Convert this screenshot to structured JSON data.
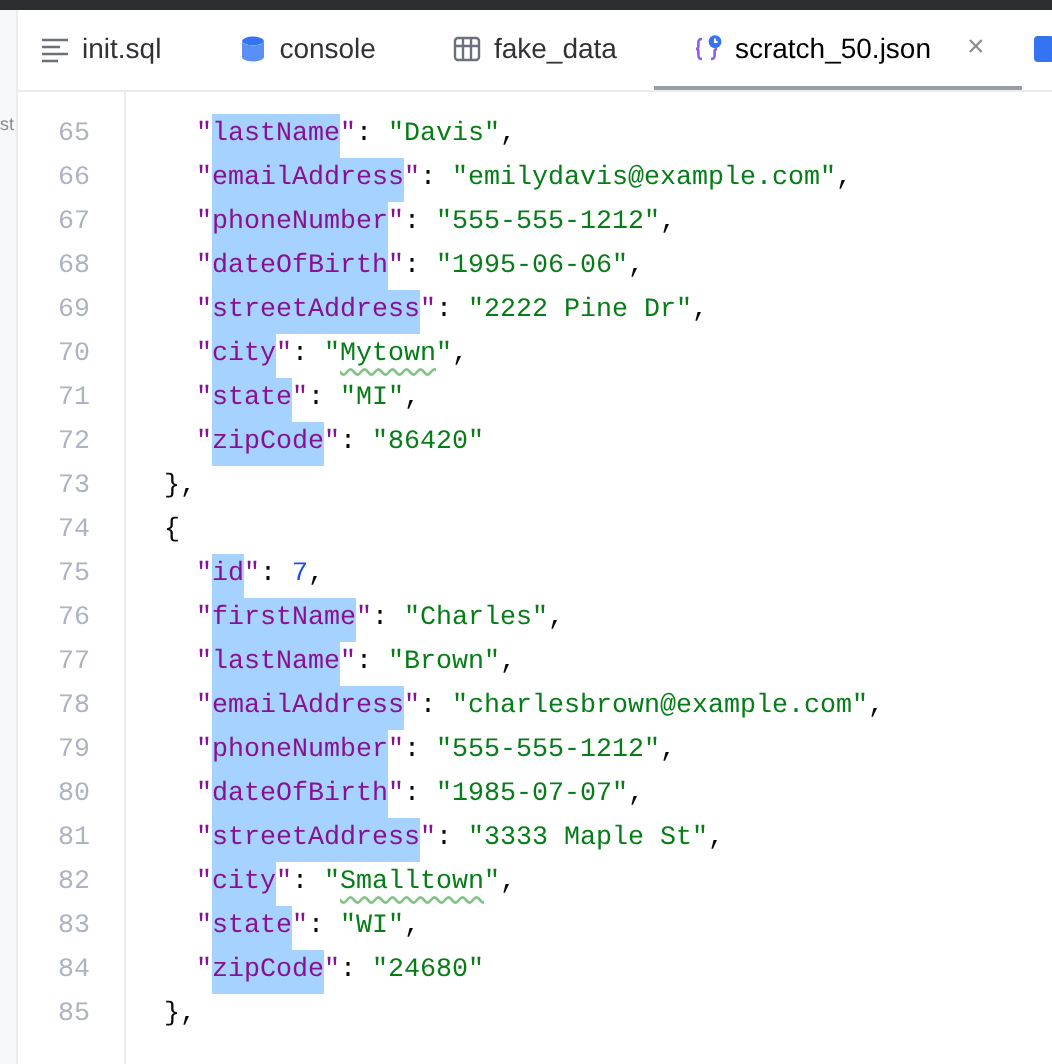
{
  "side_panel": {
    "text": "st"
  },
  "tabs": [
    {
      "label": "init.sql",
      "selected": false
    },
    {
      "label": "console",
      "selected": false
    },
    {
      "label": "fake_data",
      "selected": false
    },
    {
      "label": "scratch_50.json",
      "selected": true,
      "close": "×"
    },
    {
      "selected": false
    }
  ],
  "editor": {
    "lines": [
      {
        "number": "65",
        "tokens": [
          {
            "kind": "key_quote",
            "text": "\""
          },
          {
            "kind": "key",
            "text": "lastName",
            "selected": true
          },
          {
            "kind": "key_quote",
            "text": "\""
          },
          {
            "kind": "punct",
            "text": ": "
          },
          {
            "kind": "string",
            "text": "\"Davis\""
          },
          {
            "kind": "punct",
            "text": ","
          }
        ]
      },
      {
        "number": "66",
        "tokens": [
          {
            "kind": "key_quote",
            "text": "\""
          },
          {
            "kind": "key",
            "text": "emailAddress",
            "selected": true
          },
          {
            "kind": "key_quote",
            "text": "\""
          },
          {
            "kind": "punct",
            "text": ": "
          },
          {
            "kind": "string",
            "text": "\"emilydavis@example.com\""
          },
          {
            "kind": "punct",
            "text": ","
          }
        ]
      },
      {
        "number": "67",
        "tokens": [
          {
            "kind": "key_quote",
            "text": "\""
          },
          {
            "kind": "key",
            "text": "phoneNumber",
            "selected": true
          },
          {
            "kind": "key_quote",
            "text": "\""
          },
          {
            "kind": "punct",
            "text": ": "
          },
          {
            "kind": "string",
            "text": "\"555-555-1212\""
          },
          {
            "kind": "punct",
            "text": ","
          }
        ]
      },
      {
        "number": "68",
        "tokens": [
          {
            "kind": "key_quote",
            "text": "\""
          },
          {
            "kind": "key",
            "text": "dateOfBirth",
            "selected": true
          },
          {
            "kind": "key_quote",
            "text": "\""
          },
          {
            "kind": "punct",
            "text": ": "
          },
          {
            "kind": "string",
            "text": "\"1995-06-06\""
          },
          {
            "kind": "punct",
            "text": ","
          }
        ]
      },
      {
        "number": "69",
        "tokens": [
          {
            "kind": "key_quote",
            "text": "\""
          },
          {
            "kind": "key",
            "text": "streetAddress",
            "selected": true
          },
          {
            "kind": "key_quote",
            "text": "\""
          },
          {
            "kind": "punct",
            "text": ": "
          },
          {
            "kind": "string",
            "text": "\"2222 Pine Dr\""
          },
          {
            "kind": "punct",
            "text": ","
          }
        ]
      },
      {
        "number": "70",
        "tokens": [
          {
            "kind": "key_quote",
            "text": "\""
          },
          {
            "kind": "key",
            "text": "city",
            "selected": true
          },
          {
            "kind": "key_quote",
            "text": "\""
          },
          {
            "kind": "punct",
            "text": ": "
          },
          {
            "kind": "string",
            "text": "\""
          },
          {
            "kind": "string",
            "text": "Mytown",
            "typo": true
          },
          {
            "kind": "string",
            "text": "\""
          },
          {
            "kind": "punct",
            "text": ","
          }
        ]
      },
      {
        "number": "71",
        "tokens": [
          {
            "kind": "key_quote",
            "text": "\""
          },
          {
            "kind": "key",
            "text": "state",
            "selected": true
          },
          {
            "kind": "key_quote",
            "text": "\""
          },
          {
            "kind": "punct",
            "text": ": "
          },
          {
            "kind": "string",
            "text": "\"MI\""
          },
          {
            "kind": "punct",
            "text": ","
          }
        ]
      },
      {
        "number": "72",
        "tokens": [
          {
            "kind": "key_quote",
            "text": "\""
          },
          {
            "kind": "key",
            "text": "zipCode",
            "selected": true
          },
          {
            "kind": "key_quote",
            "text": "\""
          },
          {
            "kind": "punct",
            "text": ": "
          },
          {
            "kind": "string",
            "text": "\"86420\""
          }
        ]
      },
      {
        "number": "73",
        "tokens": [
          {
            "kind": "punct",
            "text": "},"
          }
        ]
      },
      {
        "number": "74",
        "tokens": [
          {
            "kind": "punct",
            "text": "{"
          }
        ]
      },
      {
        "number": "75",
        "tokens": [
          {
            "kind": "key_quote",
            "text": "\""
          },
          {
            "kind": "key",
            "text": "id",
            "selected": true
          },
          {
            "kind": "key_quote",
            "text": "\""
          },
          {
            "kind": "punct",
            "text": ": "
          },
          {
            "kind": "number",
            "text": "7"
          },
          {
            "kind": "punct",
            "text": ","
          }
        ]
      },
      {
        "number": "76",
        "tokens": [
          {
            "kind": "key_quote",
            "text": "\""
          },
          {
            "kind": "key",
            "text": "firstName",
            "selected": true
          },
          {
            "kind": "key_quote",
            "text": "\""
          },
          {
            "kind": "punct",
            "text": ": "
          },
          {
            "kind": "string",
            "text": "\"Charles\""
          },
          {
            "kind": "punct",
            "text": ","
          }
        ]
      },
      {
        "number": "77",
        "tokens": [
          {
            "kind": "key_quote",
            "text": "\""
          },
          {
            "kind": "key",
            "text": "lastName",
            "selected": true
          },
          {
            "kind": "key_quote",
            "text": "\""
          },
          {
            "kind": "punct",
            "text": ": "
          },
          {
            "kind": "string",
            "text": "\"Brown\""
          },
          {
            "kind": "punct",
            "text": ","
          }
        ]
      },
      {
        "number": "78",
        "tokens": [
          {
            "kind": "key_quote",
            "text": "\""
          },
          {
            "kind": "key",
            "text": "emailAddress",
            "selected": true
          },
          {
            "kind": "key_quote",
            "text": "\""
          },
          {
            "kind": "punct",
            "text": ": "
          },
          {
            "kind": "string",
            "text": "\"charlesbrown@example.com\""
          },
          {
            "kind": "punct",
            "text": ","
          }
        ]
      },
      {
        "number": "79",
        "tokens": [
          {
            "kind": "key_quote",
            "text": "\""
          },
          {
            "kind": "key",
            "text": "phoneNumber",
            "selected": true
          },
          {
            "kind": "key_quote",
            "text": "\""
          },
          {
            "kind": "punct",
            "text": ": "
          },
          {
            "kind": "string",
            "text": "\"555-555-1212\""
          },
          {
            "kind": "punct",
            "text": ","
          }
        ]
      },
      {
        "number": "80",
        "tokens": [
          {
            "kind": "key_quote",
            "text": "\""
          },
          {
            "kind": "key",
            "text": "dateOfBirth",
            "selected": true
          },
          {
            "kind": "key_quote",
            "text": "\""
          },
          {
            "kind": "punct",
            "text": ": "
          },
          {
            "kind": "string",
            "text": "\"1985-07-07\""
          },
          {
            "kind": "punct",
            "text": ","
          }
        ]
      },
      {
        "number": "81",
        "tokens": [
          {
            "kind": "key_quote",
            "text": "\""
          },
          {
            "kind": "key",
            "text": "streetAddress",
            "selected": true
          },
          {
            "kind": "key_quote",
            "text": "\""
          },
          {
            "kind": "punct",
            "text": ": "
          },
          {
            "kind": "string",
            "text": "\"3333 Maple St\""
          },
          {
            "kind": "punct",
            "text": ","
          }
        ]
      },
      {
        "number": "82",
        "tokens": [
          {
            "kind": "key_quote",
            "text": "\""
          },
          {
            "kind": "key",
            "text": "city",
            "selected": true
          },
          {
            "kind": "key_quote",
            "text": "\""
          },
          {
            "kind": "punct",
            "text": ": "
          },
          {
            "kind": "string",
            "text": "\""
          },
          {
            "kind": "string",
            "text": "Smalltown",
            "typo": true
          },
          {
            "kind": "string",
            "text": "\""
          },
          {
            "kind": "punct",
            "text": ","
          }
        ]
      },
      {
        "number": "83",
        "tokens": [
          {
            "kind": "key_quote",
            "text": "\""
          },
          {
            "kind": "key",
            "text": "state",
            "selected": true
          },
          {
            "kind": "key_quote",
            "text": "\""
          },
          {
            "kind": "punct",
            "text": ": "
          },
          {
            "kind": "string",
            "text": "\"WI\""
          },
          {
            "kind": "punct",
            "text": ","
          }
        ]
      },
      {
        "number": "84",
        "tokens": [
          {
            "kind": "key_quote",
            "text": "\""
          },
          {
            "kind": "key",
            "text": "zipCode",
            "selected": true
          },
          {
            "kind": "key_quote",
            "text": "\""
          },
          {
            "kind": "punct",
            "text": ": "
          },
          {
            "kind": "string",
            "text": "\"24680\""
          }
        ]
      },
      {
        "number": "85",
        "tokens": [
          {
            "kind": "punct",
            "text": "},"
          }
        ]
      }
    ]
  }
}
